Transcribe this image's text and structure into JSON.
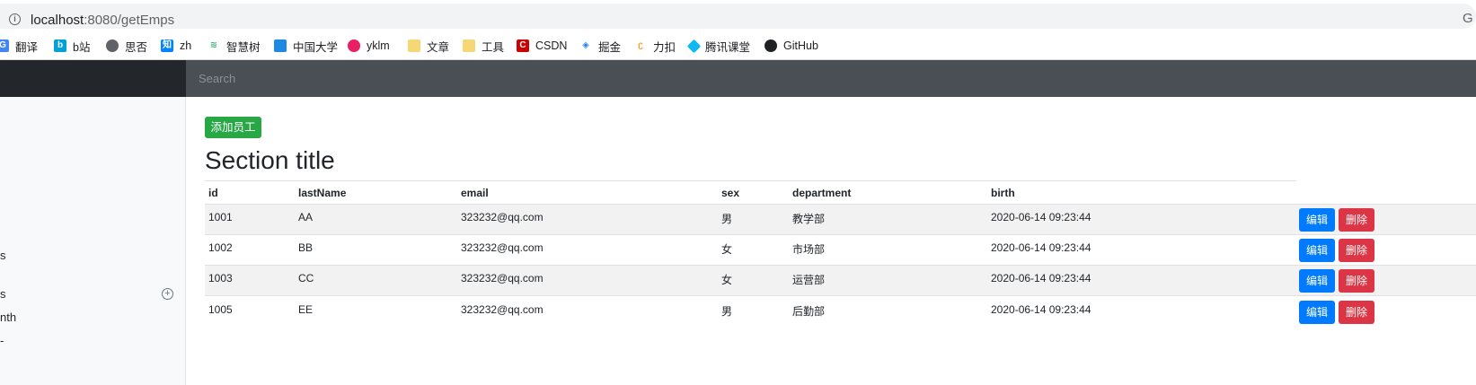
{
  "browser": {
    "url_host": "localhost",
    "url_rest": ":8080/getEmps",
    "right_glyph": "G"
  },
  "bookmarks": [
    {
      "label": "翻译",
      "icon": "google-translate-icon",
      "color": "#4285f4"
    },
    {
      "label": "b站",
      "icon": "bilibili-icon",
      "color": "#00a1d6"
    },
    {
      "label": "思否",
      "icon": "globe-icon",
      "color": "#5f6368"
    },
    {
      "label": "zh",
      "icon": "zhihu-icon",
      "color": "#0084ff"
    },
    {
      "label": "智慧树",
      "icon": "zhihuishu-icon",
      "color": "#3cb371"
    },
    {
      "label": "中国大学",
      "icon": "mooc-icon",
      "color": "#1e88e5"
    },
    {
      "label": "yklm",
      "icon": "yklm-icon",
      "color": "#e91e63"
    },
    {
      "label": "文章",
      "icon": "folder-icon",
      "color": "#f6d776"
    },
    {
      "label": "工具",
      "icon": "folder-icon",
      "color": "#f6d776"
    },
    {
      "label": "CSDN",
      "icon": "csdn-icon",
      "color": "#c00"
    },
    {
      "label": "掘金",
      "icon": "juejin-icon",
      "color": "#1e80ff"
    },
    {
      "label": "力扣",
      "icon": "leetcode-icon",
      "color": "#202124"
    },
    {
      "label": "腾讯课堂",
      "icon": "tencent-classroom-icon",
      "color": "#12b7f5"
    },
    {
      "label": "GitHub",
      "icon": "github-icon",
      "color": "#202124"
    }
  ],
  "navbar": {
    "search_placeholder": "Search"
  },
  "sidebar": {
    "fragments": [
      "s",
      "s",
      "nth",
      "-"
    ]
  },
  "main": {
    "add_button": "添加员工",
    "section_title": "Section title",
    "columns": [
      "id",
      "lastName",
      "email",
      "sex",
      "department",
      "birth"
    ],
    "edit_label": "编辑",
    "delete_label": "删除",
    "rows": [
      {
        "id": "1001",
        "lastName": "AA",
        "email": "323232@qq.com",
        "sex": "男",
        "department": "教学部",
        "birth": "2020-06-14 09:23:44"
      },
      {
        "id": "1002",
        "lastName": "BB",
        "email": "323232@qq.com",
        "sex": "女",
        "department": "市场部",
        "birth": "2020-06-14 09:23:44"
      },
      {
        "id": "1003",
        "lastName": "CC",
        "email": "323232@qq.com",
        "sex": "女",
        "department": "运营部",
        "birth": "2020-06-14 09:23:44"
      },
      {
        "id": "1005",
        "lastName": "EE",
        "email": "323232@qq.com",
        "sex": "男",
        "department": "后勤部",
        "birth": "2020-06-14 09:23:44"
      }
    ]
  }
}
